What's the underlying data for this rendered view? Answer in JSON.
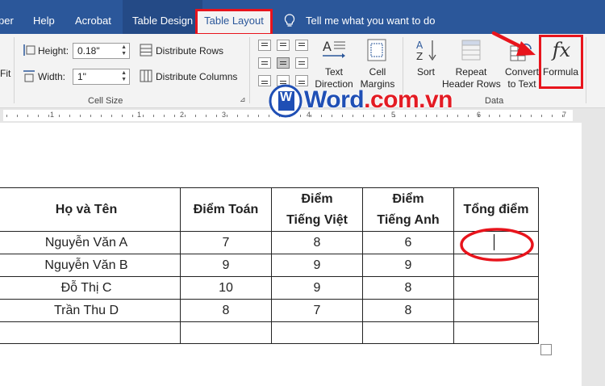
{
  "tabs": {
    "partial": "per",
    "help": "Help",
    "acrobat": "Acrobat",
    "table_design": "Table Design",
    "table_layout": "Table Layout",
    "tell_me": "Tell me what you want to do"
  },
  "cell_size": {
    "autofit_partial": "Fit",
    "height_label": "Height:",
    "height_value": "0.18\"",
    "width_label": "Width:",
    "width_value": "1\"",
    "distribute_rows": "Distribute Rows",
    "distribute_columns": "Distribute Columns",
    "group_label": "Cell Size"
  },
  "alignment": {
    "text_direction_1": "Text",
    "text_direction_2": "Direction",
    "cell_margins_1": "Cell",
    "cell_margins_2": "Margins"
  },
  "data": {
    "sort": "Sort",
    "repeat_1": "Repeat",
    "repeat_2": "Header Rows",
    "convert_1": "Convert",
    "convert_2": "to Text",
    "formula_icon": "fx",
    "formula": "Formula",
    "group_label": "Data"
  },
  "ruler": {
    "numbers": [
      "1",
      "1",
      "2",
      "3",
      "4",
      "5",
      "6",
      "7"
    ]
  },
  "watermark": {
    "letter": "W",
    "text": "Word.com.vn"
  },
  "table": {
    "headers": {
      "name": "Họ và Tên",
      "math": "Điểm Toán",
      "viet_1": "Điểm",
      "viet_2": "Tiếng Việt",
      "eng_1": "Điểm",
      "eng_2": "Tiếng Anh",
      "total": "Tổng điểm"
    },
    "rows": [
      [
        "Nguyễn Văn A",
        "7",
        "8",
        "6",
        ""
      ],
      [
        "Nguyễn Văn B",
        "9",
        "9",
        "9",
        ""
      ],
      [
        "Đỗ Thị C",
        "10",
        "9",
        "8",
        ""
      ],
      [
        "Trần Thu D",
        "8",
        "7",
        "8",
        ""
      ],
      [
        "",
        "",
        "",
        "",
        ""
      ]
    ]
  },
  "colors": {
    "ribbon_blue": "#2b579a",
    "highlight_red": "#e8141c",
    "watermark_blue": "#1f4fb5",
    "watermark_red": "#e31b23"
  }
}
